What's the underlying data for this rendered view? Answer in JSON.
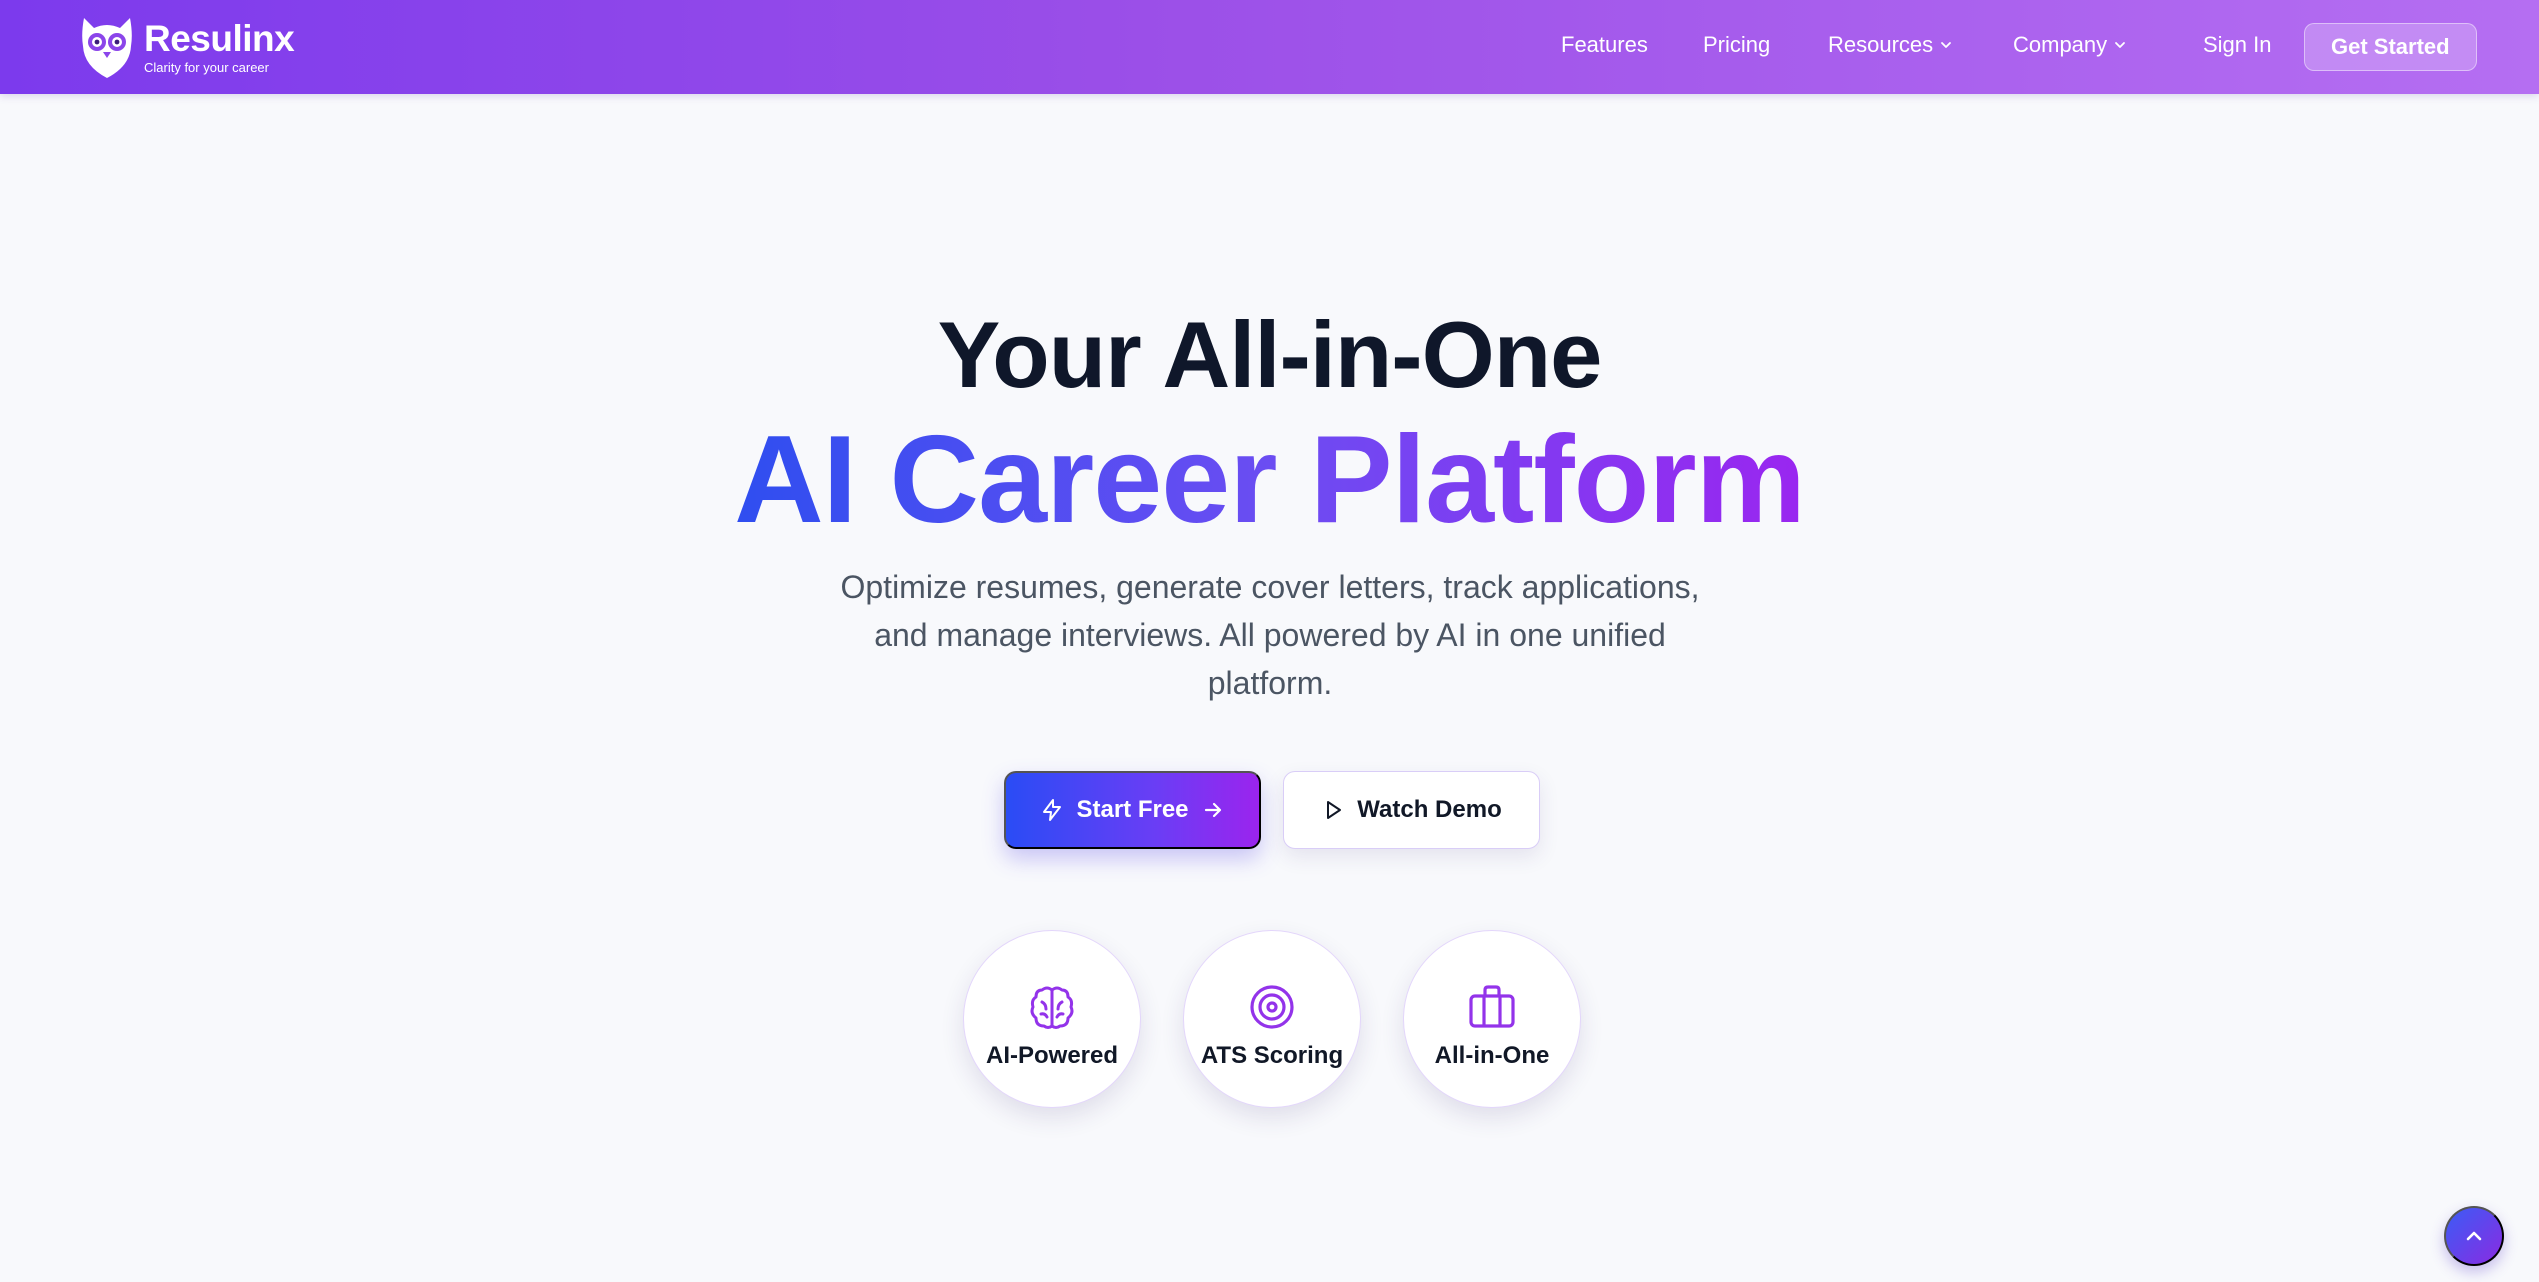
{
  "brand": {
    "name": "Resulinx",
    "tagline": "Clarity for your career"
  },
  "nav": {
    "features": "Features",
    "pricing": "Pricing",
    "resources": "Resources",
    "company": "Company",
    "sign_in": "Sign In",
    "get_started": "Get Started"
  },
  "hero": {
    "line1": "Your All-in-One",
    "line2": "AI Career Platform",
    "subtitle": "Optimize resumes, generate cover letters, track applications, and manage interviews. All powered by AI in one unified platform."
  },
  "cta": {
    "primary": "Start Free",
    "secondary": "Watch Demo"
  },
  "features": [
    {
      "label": "AI-Powered",
      "icon": "brain-icon"
    },
    {
      "label": "ATS Scoring",
      "icon": "target-icon"
    },
    {
      "label": "All-in-One",
      "icon": "briefcase-icon"
    }
  ],
  "colors": {
    "nav_gradient_start": "#7c3aed",
    "nav_gradient_end": "#b56ef2",
    "accent_blue": "#2f4ef0",
    "accent_purple": "#9a26f0",
    "icon_purple": "#9333ea"
  }
}
